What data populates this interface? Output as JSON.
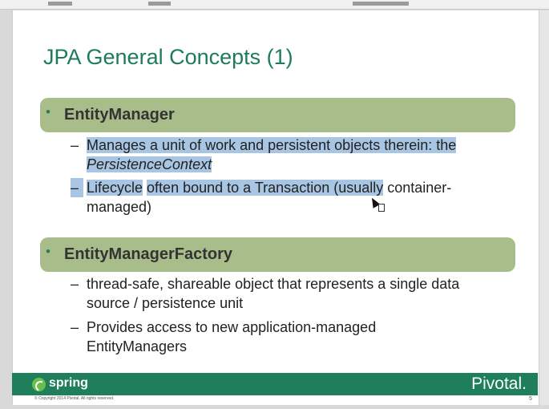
{
  "slide": {
    "title": "JPA General Concepts (1)",
    "sections": [
      {
        "label": "EntityManager",
        "items": [
          {
            "line1": "Manages a unit of work and persistent objects therein: the",
            "line2": "PersistenceContext"
          },
          {
            "line1_part1": "Lifecycle",
            "line1_part2": "often bound to a Transaction (usually",
            "line1_part3": " container-",
            "line2": "managed)"
          }
        ]
      },
      {
        "label": "EntityManagerFactory",
        "items": [
          {
            "line1": "thread-safe, shareable object that represents a single data",
            "line2": "source / persistence unit"
          },
          {
            "line1": "Provides access to new application-managed",
            "line2": "EntityManagers"
          }
        ]
      }
    ],
    "bullet": "•",
    "dash": "–"
  },
  "footer": {
    "brand_left": "spring",
    "brand_right": "Pivotal.",
    "copyright": "© Copyright 2014 Pivotal. All rights reserved.",
    "page_number": "5"
  },
  "colors": {
    "title": "#1e7b5a",
    "band": "#a9bd8a",
    "highlight": "#a8c6e3",
    "footer": "#1f7f5b"
  }
}
